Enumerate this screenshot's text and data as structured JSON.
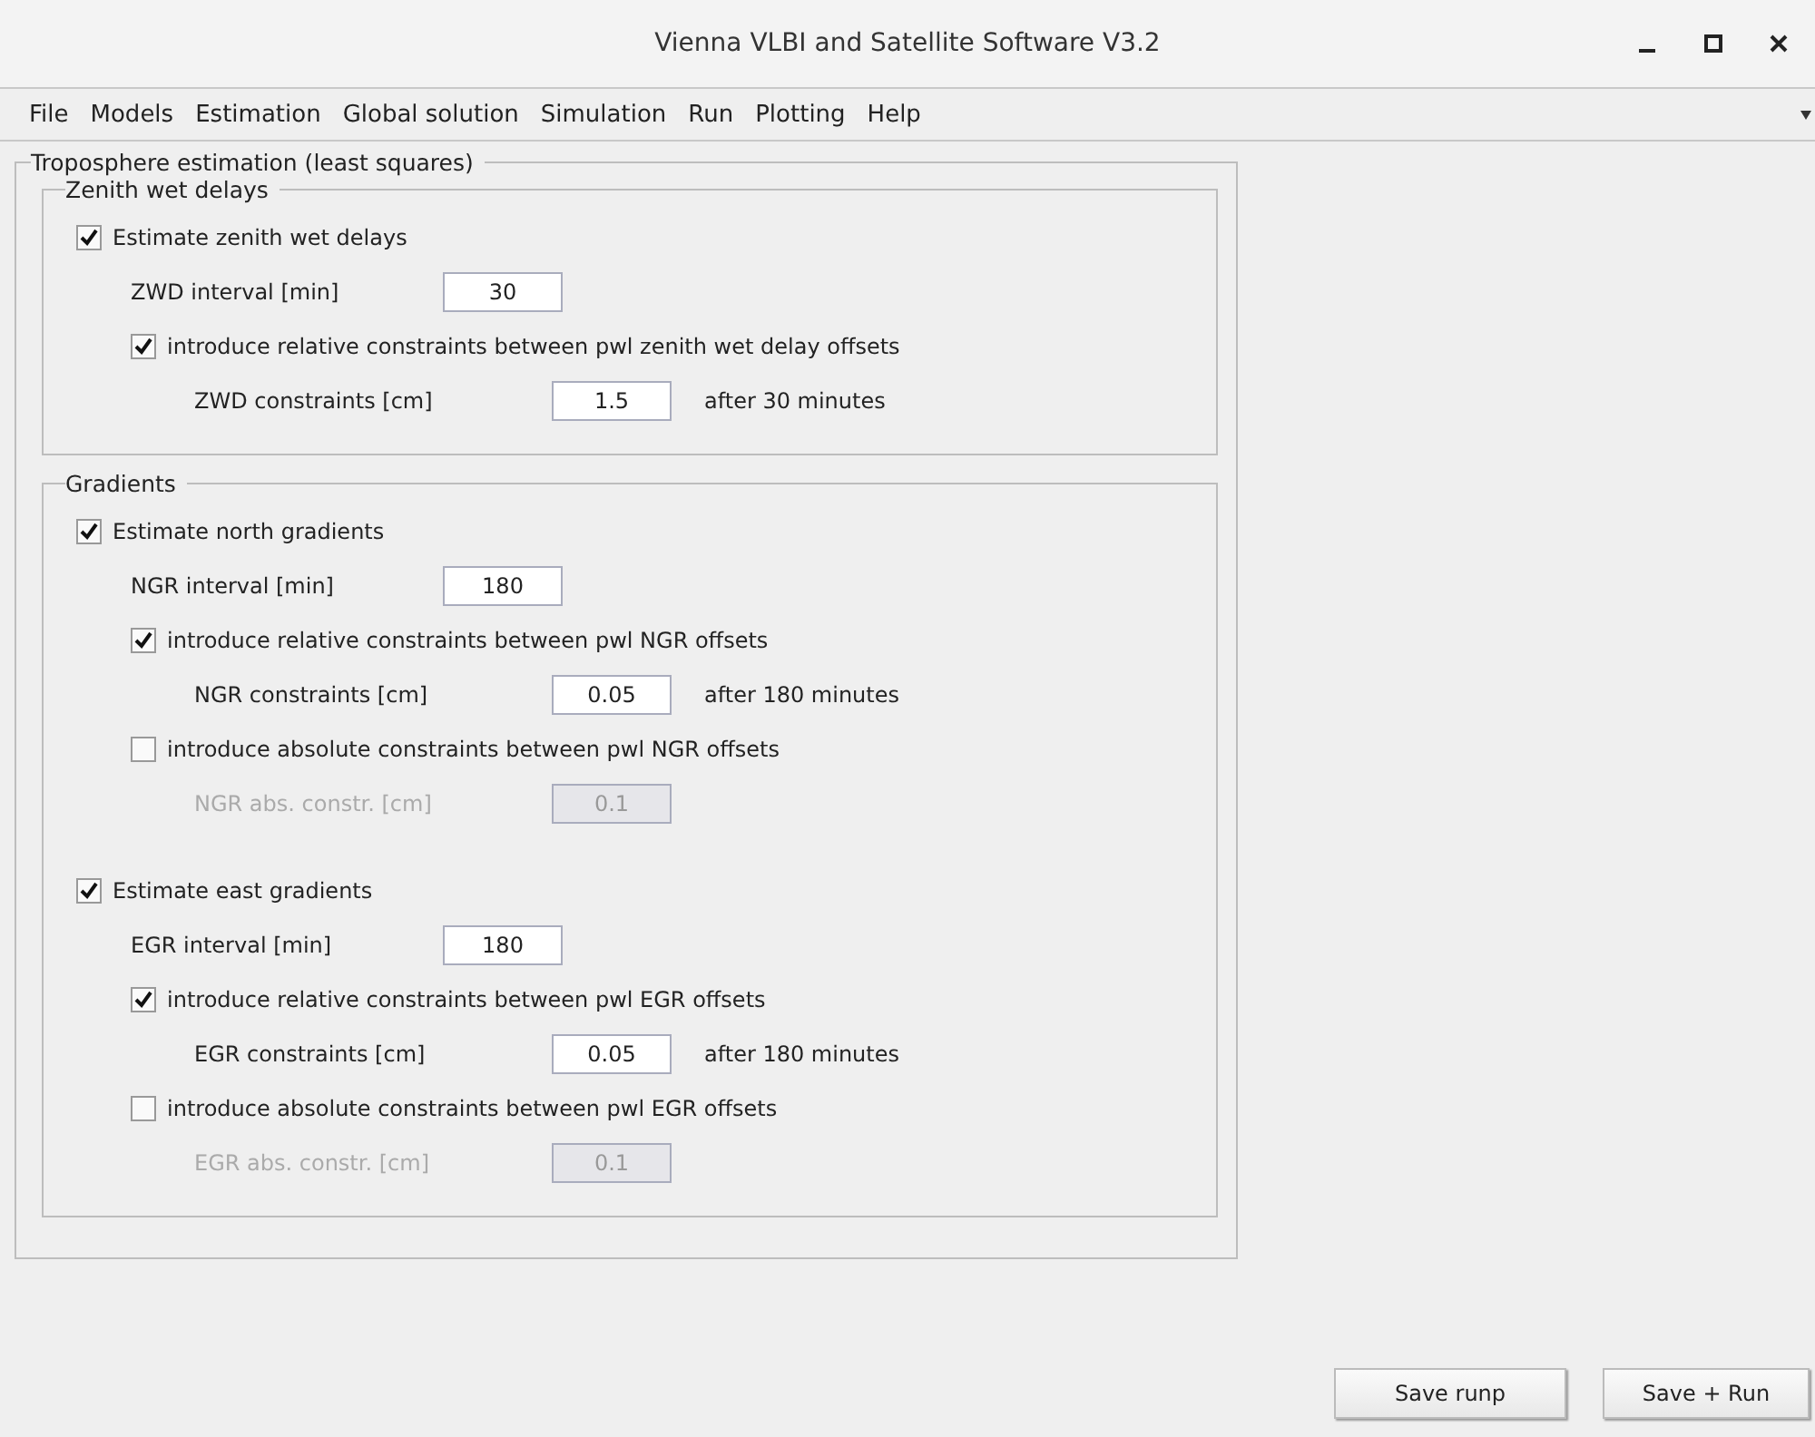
{
  "window": {
    "title": "Vienna VLBI and Satellite Software V3.2"
  },
  "menu": [
    "File",
    "Models",
    "Estimation",
    "Global solution",
    "Simulation",
    "Run",
    "Plotting",
    "Help"
  ],
  "panel": {
    "title": "Troposphere estimation (least squares)",
    "groups": [
      {
        "title": "Zenith wet delays",
        "items": [
          {
            "kind": "checkbox",
            "label": "Estimate zenith wet delays",
            "checked": true,
            "children": [
              {
                "kind": "field",
                "label": "ZWD interval [min]",
                "value": "30",
                "disabled": false
              },
              {
                "kind": "checkbox",
                "label": "introduce relative constraints between pwl zenith wet delay offsets",
                "checked": true,
                "children": [
                  {
                    "kind": "field",
                    "label": "ZWD constraints [cm]",
                    "value": "1.5",
                    "suffix": "after 30 minutes",
                    "disabled": false
                  }
                ]
              }
            ]
          }
        ]
      },
      {
        "title": "Gradients",
        "items": [
          {
            "kind": "checkbox",
            "label": "Estimate north gradients",
            "checked": true,
            "children": [
              {
                "kind": "field",
                "label": "NGR interval [min]",
                "value": "180",
                "disabled": false
              },
              {
                "kind": "checkbox",
                "label": "introduce relative constraints between pwl NGR offsets",
                "checked": true,
                "children": [
                  {
                    "kind": "field",
                    "label": "NGR constraints [cm]",
                    "value": "0.05",
                    "suffix": "after 180 minutes",
                    "disabled": false
                  }
                ]
              },
              {
                "kind": "checkbox",
                "label": "introduce absolute constraints between pwl NGR offsets",
                "checked": false,
                "children": [
                  {
                    "kind": "field",
                    "label": "NGR abs. constr. [cm]",
                    "value": "0.1",
                    "disabled": true
                  }
                ]
              }
            ]
          },
          {
            "kind": "checkbox",
            "label": "Estimate east gradients",
            "checked": true,
            "children": [
              {
                "kind": "field",
                "label": "EGR interval [min]",
                "value": "180",
                "disabled": false
              },
              {
                "kind": "checkbox",
                "label": "introduce relative constraints between pwl EGR offsets",
                "checked": true,
                "children": [
                  {
                    "kind": "field",
                    "label": "EGR constraints [cm]",
                    "value": "0.05",
                    "suffix": "after 180 minutes",
                    "disabled": false
                  }
                ]
              },
              {
                "kind": "checkbox",
                "label": "introduce absolute constraints between pwl EGR offsets",
                "checked": false,
                "children": [
                  {
                    "kind": "field",
                    "label": "EGR abs. constr. [cm]",
                    "value": "0.1",
                    "disabled": true
                  }
                ]
              }
            ]
          }
        ]
      }
    ]
  },
  "buttons": [
    "Save runp",
    "Save + Run"
  ]
}
